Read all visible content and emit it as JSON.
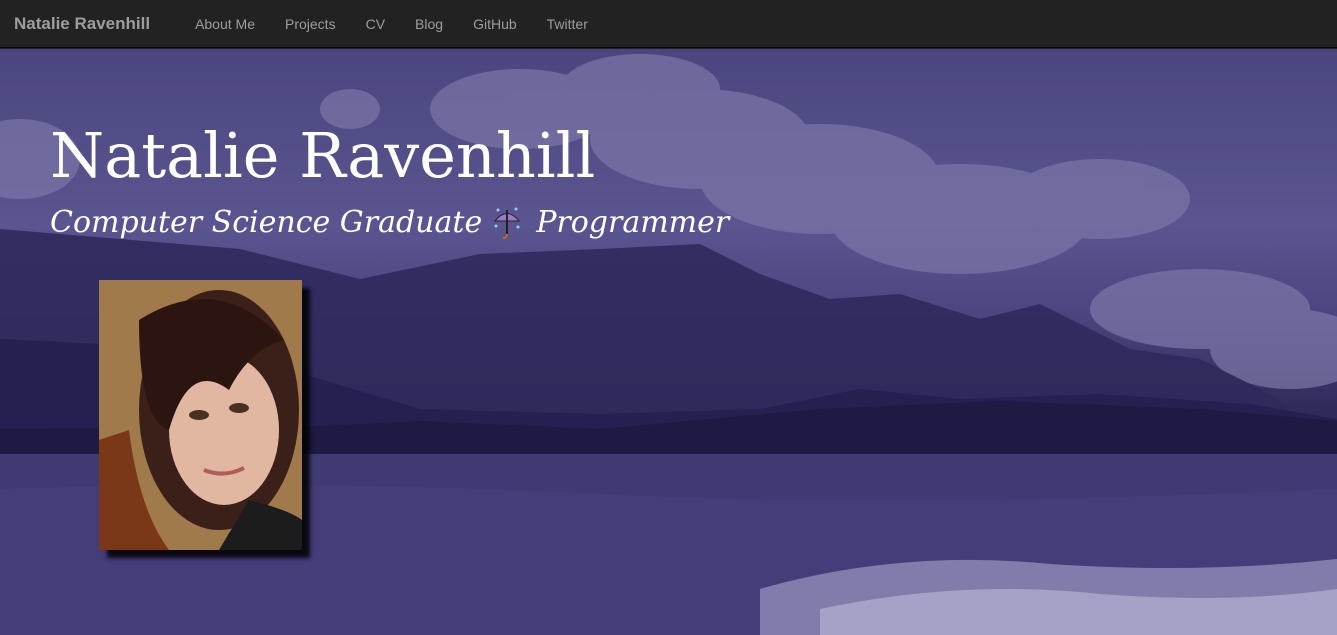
{
  "navbar": {
    "brand": "Natalie Ravenhill",
    "links": [
      "About Me",
      "Projects",
      "CV",
      "Blog",
      "GitHub",
      "Twitter"
    ]
  },
  "hero": {
    "title": "Natalie Ravenhill",
    "subtitle_left": "Computer Science Graduate",
    "subtitle_icon": "umbrella-with-rain-icon",
    "subtitle_right": "Programmer"
  },
  "photo": {
    "icon": "portrait-photo"
  },
  "colors": {
    "navbar_bg": "#222222",
    "nav_text": "#9d9d9d",
    "hero_overlay": "#4a4580",
    "title_text": "#ffffff"
  }
}
